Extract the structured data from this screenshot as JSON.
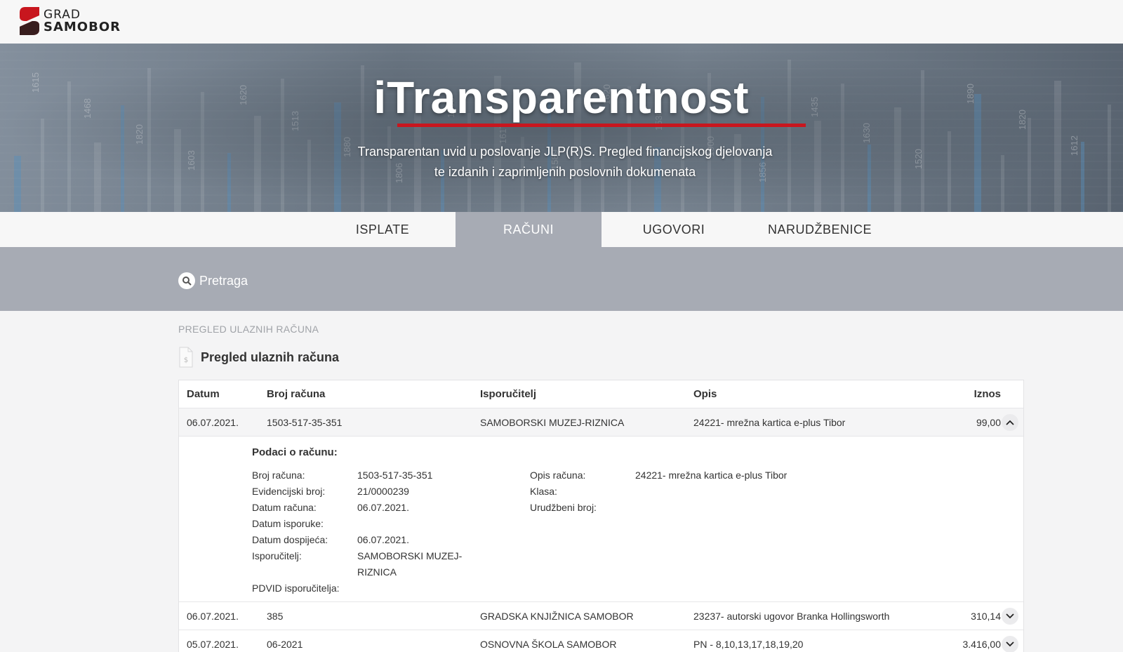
{
  "brand": {
    "line1": "GRAD",
    "line2": "SAMOBOR"
  },
  "hero": {
    "title": "iTransparentnost",
    "subtitle": "Transparentan uvid u poslovanje JLP(R)S. Pregled financijskog djelovanja te izdanih i zaprimljenih poslovnih dokumenata",
    "bg_numbers": [
      "1615",
      "1468",
      "1820",
      "1603",
      "1620",
      "1513",
      "1880",
      "1806",
      "1605",
      "1617",
      "1589",
      "1620",
      "1530",
      "1900",
      "1856",
      "1435",
      "1630",
      "1520",
      "1890",
      "1820",
      "1612"
    ]
  },
  "tabs": [
    {
      "label": "ISPLATE",
      "active": false
    },
    {
      "label": "RAČUNI",
      "active": true
    },
    {
      "label": "UGOVORI",
      "active": false
    },
    {
      "label": "NARUDŽBENICE",
      "active": false
    }
  ],
  "search": {
    "label": "Pretraga"
  },
  "breadcrumb": "PREGLED ULAZNIH RAČUNA",
  "section_title": "Pregled ulaznih računa",
  "table": {
    "headers": {
      "date": "Datum",
      "number": "Broj računa",
      "supplier": "Isporučitelj",
      "description": "Opis",
      "amount": "Iznos"
    },
    "rows": [
      {
        "date": "06.07.2021.",
        "number": "1503-517-35-351",
        "supplier": "SAMOBORSKI MUZEJ-RIZNICA",
        "description": "24221- mrežna kartica e-plus Tibor",
        "amount": "99,00",
        "expanded": true
      },
      {
        "date": "06.07.2021.",
        "number": "385",
        "supplier": "GRADSKA KNJIŽNICA SAMOBOR",
        "description": "23237- autorski ugovor Branka Hollingsworth",
        "amount": "310,14",
        "expanded": false
      },
      {
        "date": "05.07.2021.",
        "number": "06-2021",
        "supplier": "OSNOVNA ŠKOLA SAMOBOR",
        "description": "PN - 8,10,13,17,18,19,20",
        "amount": "3.416,00",
        "expanded": false
      }
    ],
    "detail": {
      "title": "Podaci o računu:",
      "left_labels": [
        "Broj računa:",
        "Evidencijski broj:",
        "Datum računa:",
        "Datum isporuke:",
        "Datum dospijeća:",
        "Isporučitelj:",
        "",
        "PDVID isporučitelja:"
      ],
      "left_values": {
        "number": "1503-517-35-351",
        "evid": "21/0000239",
        "date": "06.07.2021.",
        "delivery": "",
        "due": "06.07.2021.",
        "supplier": "SAMOBORSKI MUZEJ-RIZNICA",
        "vat": ""
      },
      "right_labels": [
        "Opis računa:",
        "Klasa:",
        "Urudžbeni broj:"
      ],
      "right_values": {
        "desc": "24221- mrežna kartica e-plus Tibor",
        "klasa": "",
        "urud": ""
      }
    }
  }
}
